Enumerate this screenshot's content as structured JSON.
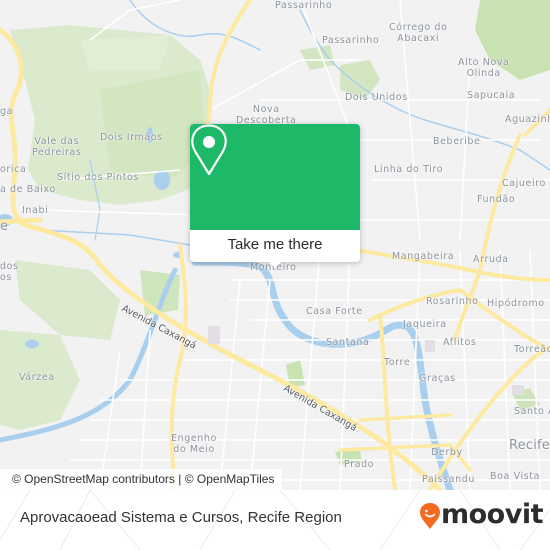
{
  "map": {
    "colors": {
      "background": "#f2f2f3",
      "park": "#d9e8c9",
      "park_dark": "#c8dfb4",
      "water": "#a9cfee",
      "major_road": "#fde9a0",
      "minor_road": "#ffffff"
    },
    "places": [
      {
        "name": "Passarinho",
        "id": "passarinho-north"
      },
      {
        "name": "Passarinho",
        "id": "passarinho"
      },
      {
        "name": "Córrego do\nAbacaxi",
        "id": "corrego-do-abacaxi"
      },
      {
        "name": "Alto Nova\nOlinda",
        "id": "alto-nova-olinda"
      },
      {
        "name": "Dois Unidos",
        "id": "dois-unidos"
      },
      {
        "name": "Sapucaia",
        "id": "sapucaia"
      },
      {
        "name": "Nova\nDescoberta",
        "id": "nova-descoberta"
      },
      {
        "name": "Aguazinha",
        "id": "aguazinha"
      },
      {
        "name": "Vale das\nPedreiras",
        "id": "vale-das-pedreiras"
      },
      {
        "name": "Dois Irmãos",
        "id": "dois-irmaos"
      },
      {
        "name": "Beberibe",
        "id": "beberibe"
      },
      {
        "name": "Linha do Tiro",
        "id": "linha-do-tiro"
      },
      {
        "name": "Sítio dos Pintos",
        "id": "sitio-dos-pintos"
      },
      {
        "name": "Cajueiro",
        "id": "cajueiro"
      },
      {
        "name": "Fundão",
        "id": "fundao"
      },
      {
        "name": "ga",
        "id": "partial-ga"
      },
      {
        "name": "orica",
        "id": "partial-orica"
      },
      {
        "name": "a de Baixo",
        "id": "partial-de-baixo"
      },
      {
        "name": "Inabi",
        "id": "inabi"
      },
      {
        "name": "Mangabeira",
        "id": "mangabeira"
      },
      {
        "name": "Arruda",
        "id": "arruda"
      },
      {
        "name": "Monteiro",
        "id": "monteiro"
      },
      {
        "name": "dos\nos",
        "id": "partial-dos"
      },
      {
        "name": "Rosarinho",
        "id": "rosarinho"
      },
      {
        "name": "Hipódromo",
        "id": "hipodromo"
      },
      {
        "name": "Casa Forte",
        "id": "casa-forte"
      },
      {
        "name": "Jaqueira",
        "id": "jaqueira"
      },
      {
        "name": "Santana",
        "id": "santana"
      },
      {
        "name": "Aflitos",
        "id": "aflitos"
      },
      {
        "name": "Torreão",
        "id": "torreao"
      },
      {
        "name": "Torre",
        "id": "torre"
      },
      {
        "name": "Várzea",
        "id": "varzea"
      },
      {
        "name": "Graças",
        "id": "gracas"
      },
      {
        "name": "Santo A",
        "id": "santo-amaro"
      },
      {
        "name": "Engenho\ndo Meio",
        "id": "engenho-do-meio"
      },
      {
        "name": "Derby",
        "id": "derby"
      },
      {
        "name": "Prado",
        "id": "prado"
      },
      {
        "name": "Paissandu",
        "id": "paissandu"
      },
      {
        "name": "Boa Vista",
        "id": "boa-vista"
      }
    ],
    "big_places": [
      {
        "name": "e",
        "id": "partial-e"
      },
      {
        "name": "Recife",
        "id": "recife"
      }
    ],
    "roads": [
      {
        "name": "Avenida Caxangá",
        "id": "avenida-caxanga-west"
      },
      {
        "name": "Avenida Caxangá",
        "id": "avenida-caxanga-east"
      }
    ],
    "attribution": "© OpenStreetMap contributors | © OpenMapTiles"
  },
  "popup": {
    "icon": "map-pin-icon",
    "button_label": "Take me there",
    "color": "#1eb968"
  },
  "footer": {
    "title": "Aprovacaoead Sistema e Cursos, Recife Region",
    "logo_text": "moovit",
    "logo_color": "#f26b21"
  }
}
